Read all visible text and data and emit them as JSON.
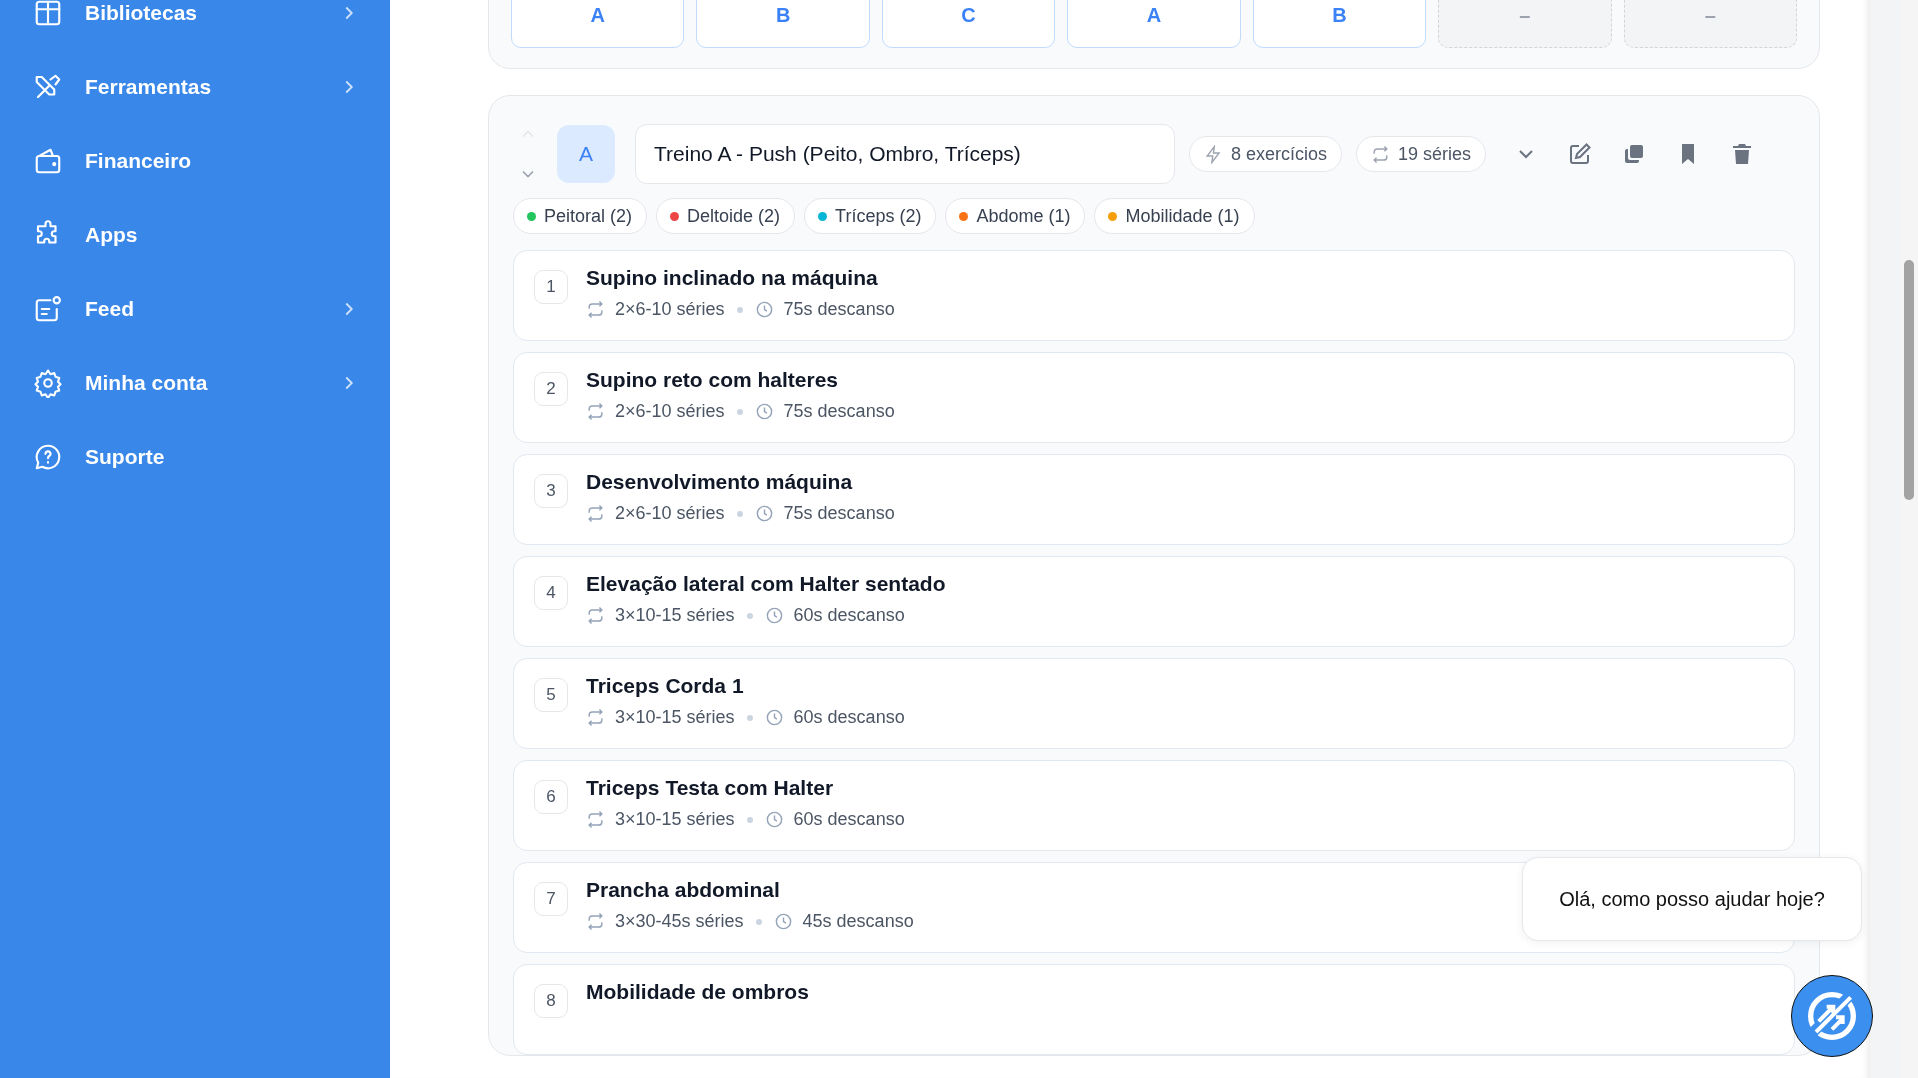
{
  "sidebar": {
    "items": [
      {
        "label": "Bibliotecas",
        "has_submenu": true
      },
      {
        "label": "Ferramentas",
        "has_submenu": true
      },
      {
        "label": "Financeiro",
        "has_submenu": false
      },
      {
        "label": "Apps",
        "has_submenu": false
      },
      {
        "label": "Feed",
        "has_submenu": true
      },
      {
        "label": "Minha conta",
        "has_submenu": true
      },
      {
        "label": "Suporte",
        "has_submenu": false
      }
    ]
  },
  "schedule": {
    "days": [
      {
        "label": "A",
        "filled": true
      },
      {
        "label": "B",
        "filled": true
      },
      {
        "label": "C",
        "filled": true
      },
      {
        "label": "A",
        "filled": true
      },
      {
        "label": "B",
        "filled": true
      },
      {
        "label": "–",
        "filled": false
      },
      {
        "label": "–",
        "filled": false
      }
    ]
  },
  "workout": {
    "badge": "A",
    "title": "Treino A - Push (Peito, Ombro, Tríceps)",
    "exercise_count": "8 exercícios",
    "series_count": "19 séries",
    "muscles": [
      {
        "label": "Peitoral (2)",
        "color": "#22c55e"
      },
      {
        "label": "Deltoide (2)",
        "color": "#ef4444"
      },
      {
        "label": "Tríceps (2)",
        "color": "#06b6d4"
      },
      {
        "label": "Abdome (1)",
        "color": "#f97316"
      },
      {
        "label": "Mobilidade (1)",
        "color": "#f59e0b"
      }
    ],
    "exercises": [
      {
        "number": "1",
        "name": "Supino inclinado na máquina",
        "sets": "2×6-10 séries",
        "rest": "75s descanso"
      },
      {
        "number": "2",
        "name": "Supino reto com halteres",
        "sets": "2×6-10 séries",
        "rest": "75s descanso"
      },
      {
        "number": "3",
        "name": "Desenvolvimento máquina",
        "sets": "2×6-10 séries",
        "rest": "75s descanso"
      },
      {
        "number": "4",
        "name": "Elevação lateral com Halter sentado",
        "sets": "3×10-15 séries",
        "rest": "60s descanso"
      },
      {
        "number": "5",
        "name": "Triceps Corda 1",
        "sets": "3×10-15 séries",
        "rest": "60s descanso"
      },
      {
        "number": "6",
        "name": "Triceps Testa com Halter",
        "sets": "3×10-15 séries",
        "rest": "60s descanso"
      },
      {
        "number": "7",
        "name": "Prancha abdominal",
        "sets": "3×30-45s séries",
        "rest": "45s descanso"
      },
      {
        "number": "8",
        "name": "Mobilidade de ombros"
      }
    ]
  },
  "chat": {
    "message": "Olá, como posso ajudar hoje?"
  }
}
